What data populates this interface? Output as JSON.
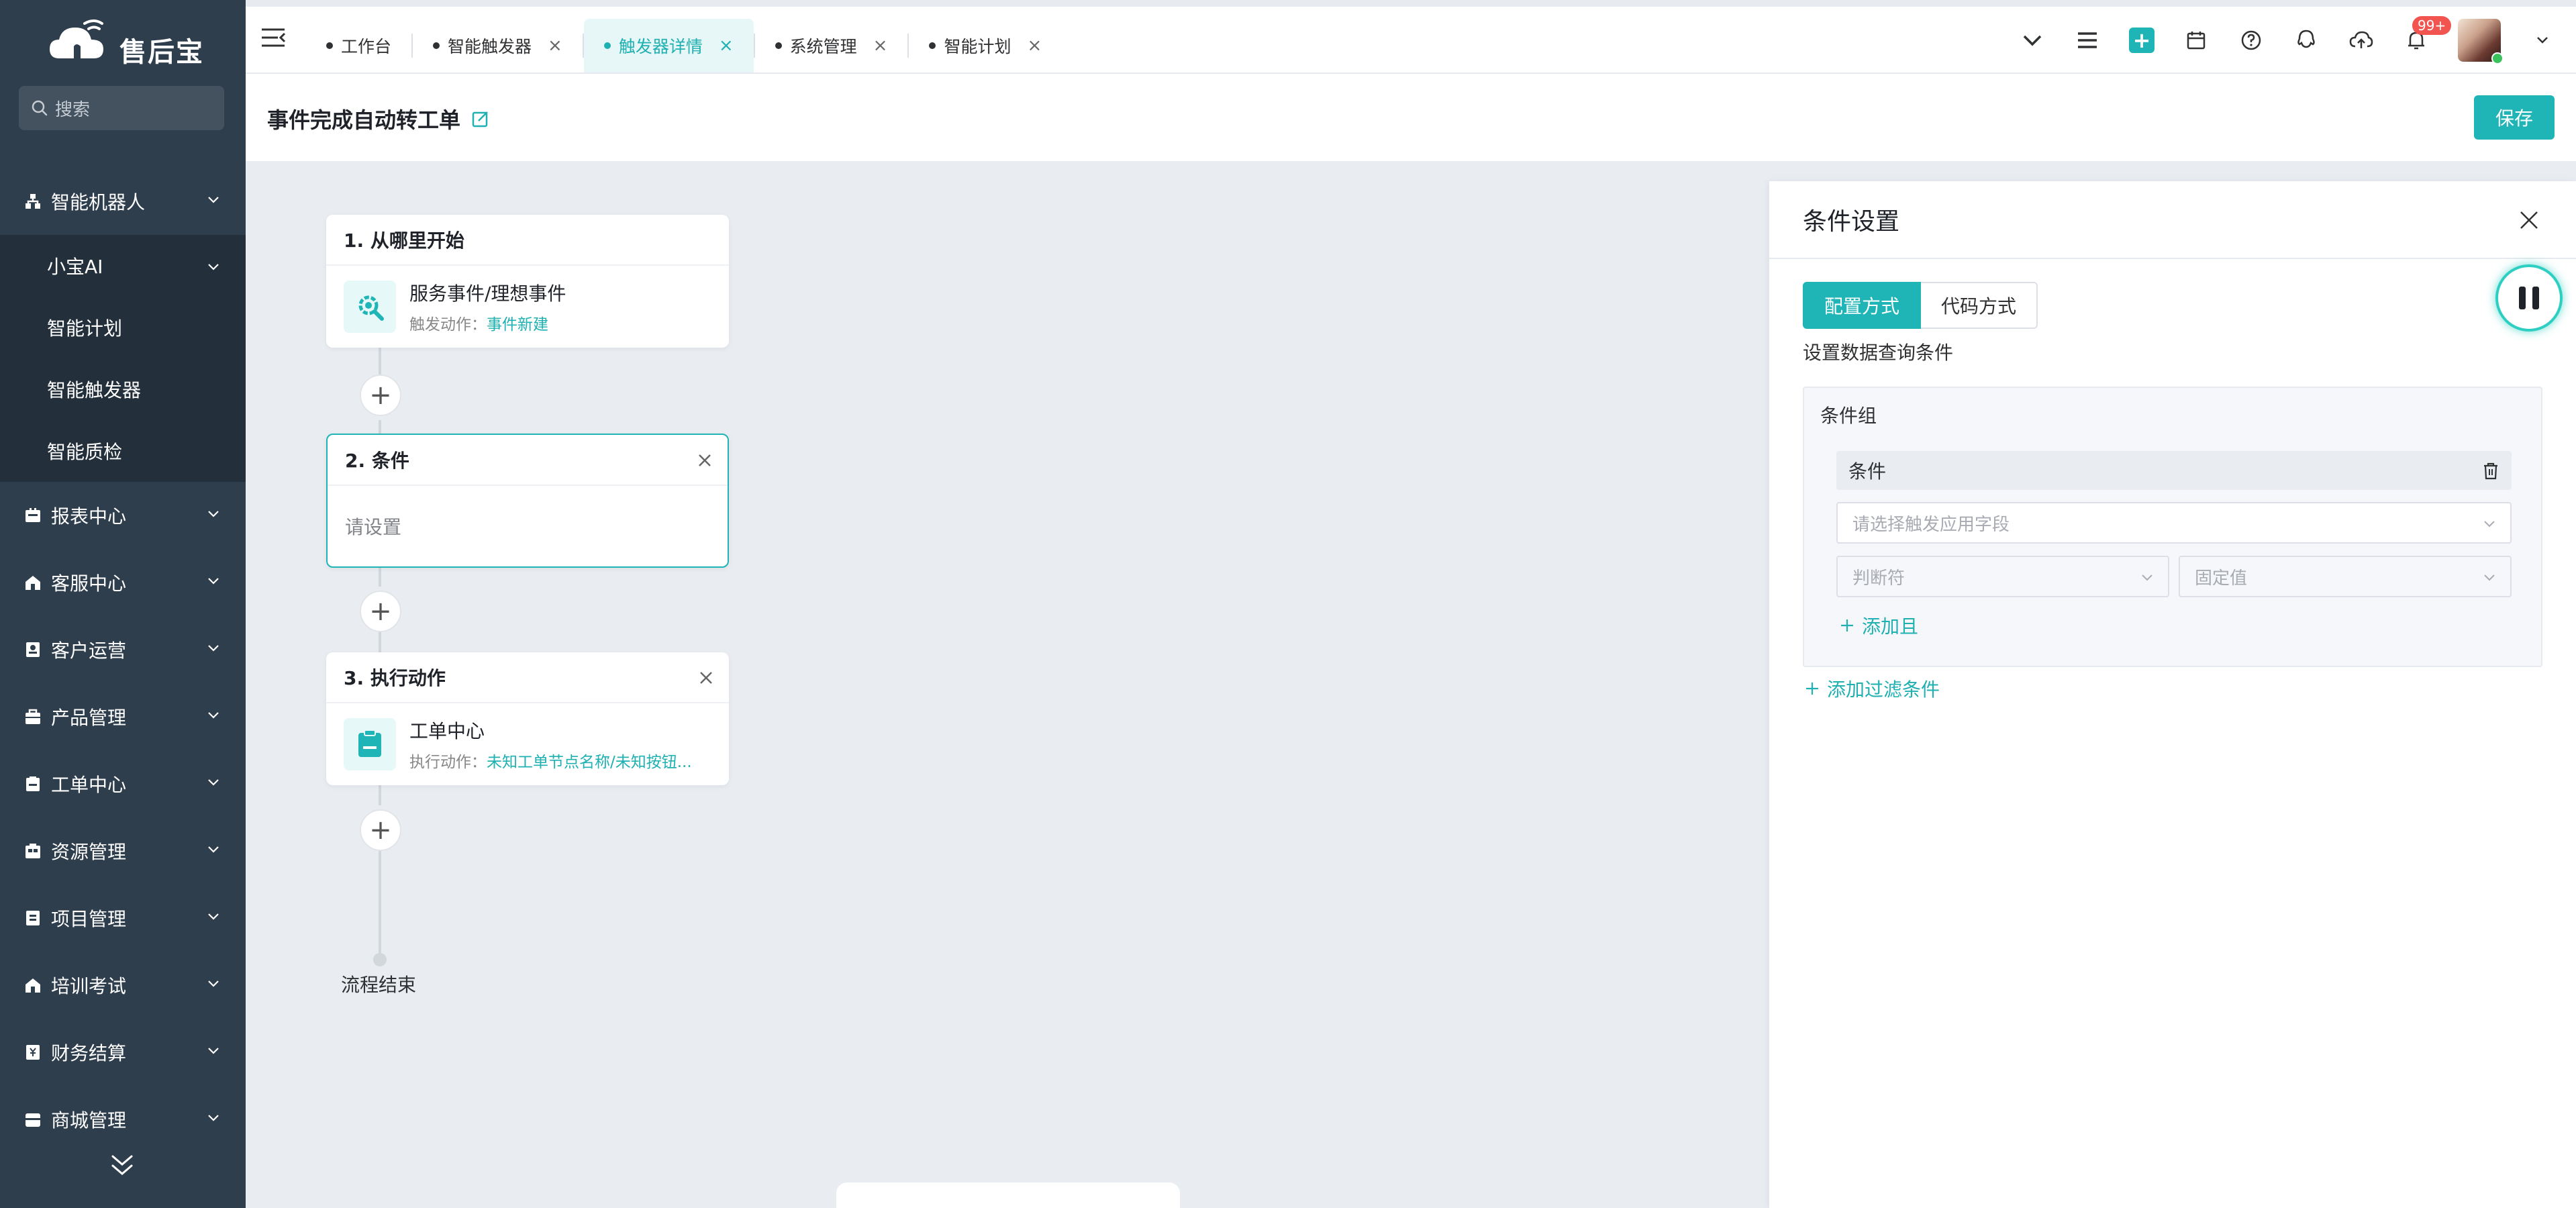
{
  "brand": {
    "name": "售后宝"
  },
  "search": {
    "placeholder": "搜索"
  },
  "sidebar": {
    "groups": [
      {
        "label": "智能机器人",
        "icon": "robot-icon"
      },
      {
        "label": "报表中心",
        "icon": "report-icon"
      },
      {
        "label": "客服中心",
        "icon": "home-icon"
      },
      {
        "label": "客户运营",
        "icon": "customer-icon"
      },
      {
        "label": "产品管理",
        "icon": "product-icon"
      },
      {
        "label": "工单中心",
        "icon": "ticket-icon"
      },
      {
        "label": "资源管理",
        "icon": "resource-icon"
      },
      {
        "label": "项目管理",
        "icon": "project-icon"
      },
      {
        "label": "培训考试",
        "icon": "training-icon"
      },
      {
        "label": "财务结算",
        "icon": "finance-icon"
      },
      {
        "label": "商城管理",
        "icon": "mall-icon"
      }
    ],
    "sub_items": [
      {
        "label": "小宝AI"
      },
      {
        "label": "智能计划"
      },
      {
        "label": "智能触发器"
      },
      {
        "label": "智能质检"
      }
    ]
  },
  "tabs": [
    {
      "label": "工作台",
      "closable": false,
      "active": false
    },
    {
      "label": "智能触发器",
      "closable": true,
      "active": false
    },
    {
      "label": "触发器详情",
      "closable": true,
      "active": true
    },
    {
      "label": "系统管理",
      "closable": true,
      "active": false
    },
    {
      "label": "智能计划",
      "closable": true,
      "active": false
    }
  ],
  "header": {
    "notification_count": "99+"
  },
  "page": {
    "title": "事件完成自动转工单",
    "save_label": "保存"
  },
  "flow": {
    "step1": {
      "title": "1.  从哪里开始",
      "main": "服务事件/理想事件",
      "sub_label": "触发动作：",
      "sub_value": "事件新建"
    },
    "step2": {
      "title": "2.  条件",
      "placeholder": "请设置"
    },
    "step3": {
      "title": "3.  执行动作",
      "main": "工单中心",
      "sub_label": "执行动作：",
      "sub_value": "未知工单节点名称/未知按钮..."
    },
    "end_label": "流程结束"
  },
  "panel": {
    "title": "条件设置",
    "mode_config": "配置方式",
    "mode_code": "代码方式",
    "query_label": "设置数据查询条件",
    "group_title": "条件组",
    "condition_label": "条件",
    "field_placeholder": "请选择触发应用字段",
    "operator_placeholder": "判断符",
    "value_placeholder": "固定值",
    "add_and": "添加且",
    "add_filter": "添加过滤条件"
  },
  "colors": {
    "accent": "#1fb5b7",
    "sidebar": "#2f3e4d",
    "badge": "#f25450"
  }
}
